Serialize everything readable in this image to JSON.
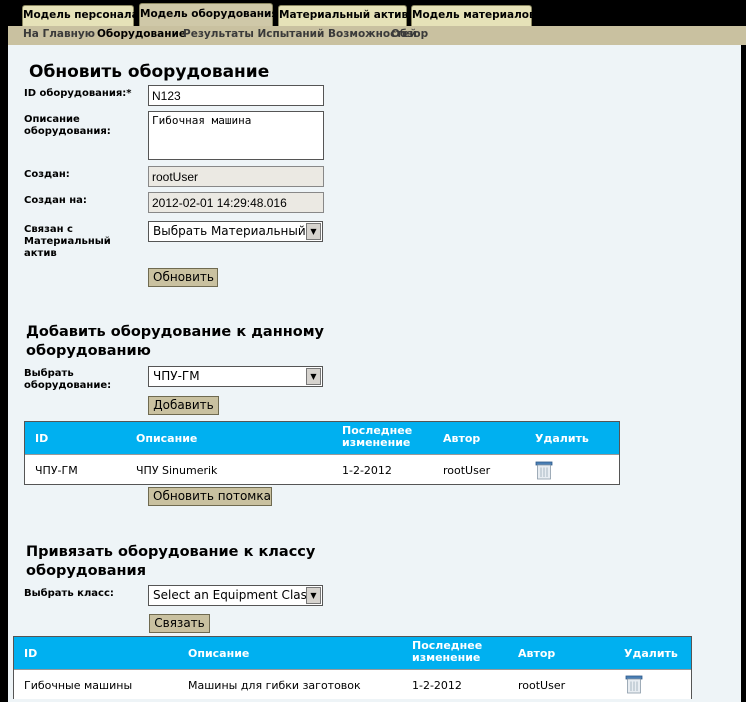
{
  "tabs": [
    {
      "label": "Модель персонала"
    },
    {
      "label": "Модель оборудования"
    },
    {
      "label": "Материальный актив"
    },
    {
      "label": "Модель материалов"
    }
  ],
  "subnav": [
    "На Главную",
    "Оборудование",
    "Результаты Испытаний Возможностей",
    "Обзор"
  ],
  "update": {
    "title": "Обновить оборудование",
    "id_label": "ID оборудования:*",
    "id_value": "N123",
    "desc_label": "Описание оборудования:",
    "desc_value": "Гибочная машина",
    "created_by_label": "Создан:",
    "created_by_value": "rootUser",
    "created_on_label": "Создан на:",
    "created_on_value": "2012-02-01 14:29:48.016",
    "linked_label": "Связан с Материальный актив",
    "linked_value": "Выбрать Материальный а",
    "update_button": "Обновить"
  },
  "add_child": {
    "title": "Добавить оборудование к данному оборудованию",
    "select_label": "Выбрать оборудование:",
    "select_value": "ЧПУ-ГМ",
    "add_button": "Добавить",
    "columns": [
      "ID",
      "Описание",
      "Последнее изменение",
      "Автор",
      "Удалить"
    ],
    "rows": [
      {
        "id": "ЧПУ-ГМ",
        "description": "ЧПУ Sinumerik",
        "modified": "1-2-2012",
        "author": "rootUser"
      }
    ],
    "refresh_button": "Обновить потомка"
  },
  "bind_class": {
    "title": "Привязать оборудование к классу оборудования",
    "select_label": "Выбрать класс:",
    "select_value": "Select an Equipment Class",
    "bind_button": "Связать",
    "columns": [
      "ID",
      "Описание",
      "Последнее изменение",
      "Автор",
      "Удалить"
    ],
    "rows": [
      {
        "id": "Гибочные машины",
        "description": "Машины для гибки заготовок",
        "modified": "1-2-2012",
        "author": "rootUser"
      }
    ]
  },
  "colors": {
    "header_blue": "#00b0f0",
    "tab_bg": "#e6e2b8",
    "subnav_bg": "#c9c1a0",
    "content_bg": "#eef4f7"
  }
}
